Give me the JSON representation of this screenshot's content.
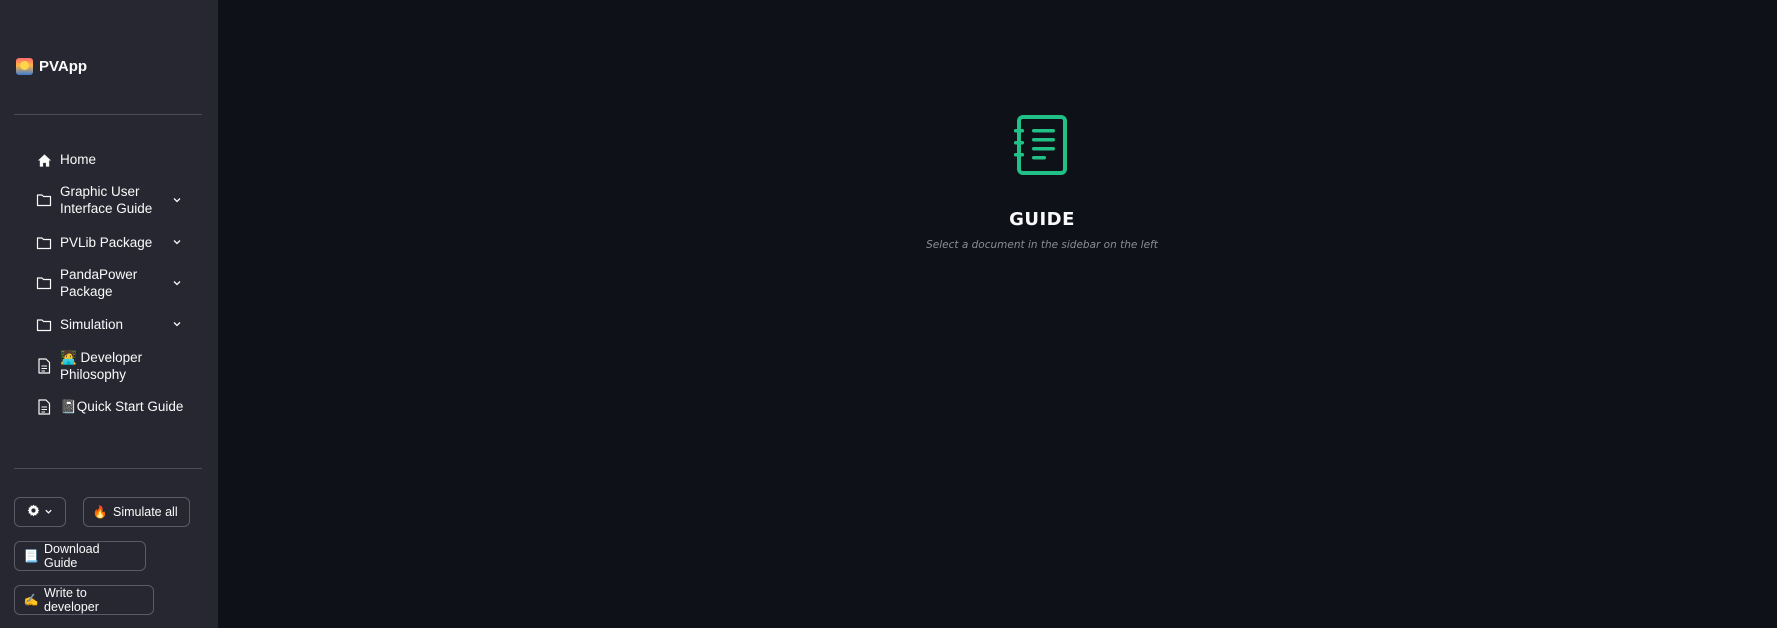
{
  "app": {
    "name": "PVApp",
    "logo_icon": "sunrise-icon"
  },
  "sidebar": {
    "items": [
      {
        "label": "Home",
        "icon": "home-icon",
        "expandable": false
      },
      {
        "label": "Graphic User Interface Guide",
        "icon": "folder-icon",
        "expandable": true
      },
      {
        "label": "PVLib Package",
        "icon": "folder-icon",
        "expandable": true
      },
      {
        "label": "PandaPower Package",
        "icon": "folder-icon",
        "expandable": true
      },
      {
        "label": "Simulation",
        "icon": "folder-icon",
        "expandable": true
      },
      {
        "label": "🧑‍💻 Developer Philosophy",
        "icon": "document-icon",
        "expandable": false
      },
      {
        "label": "📓Quick Start Guide",
        "icon": "document-icon",
        "expandable": false
      }
    ],
    "buttons": {
      "settings_icon": "gear-icon",
      "simulate_all": "Simulate all",
      "simulate_all_emoji": "🔥",
      "download_guide": "Download Guide",
      "download_guide_emoji": "📃",
      "write_developer": "Write to developer",
      "write_developer_emoji": "✍️"
    }
  },
  "main": {
    "icon": "guide-book-icon",
    "title": "GUIDE",
    "subtitle": "Select a document in the sidebar on the left"
  },
  "colors": {
    "background": "#0f1118",
    "sidebar": "#262730",
    "accent": "#21c087",
    "text": "#fafafa",
    "muted": "#8a8c96"
  }
}
